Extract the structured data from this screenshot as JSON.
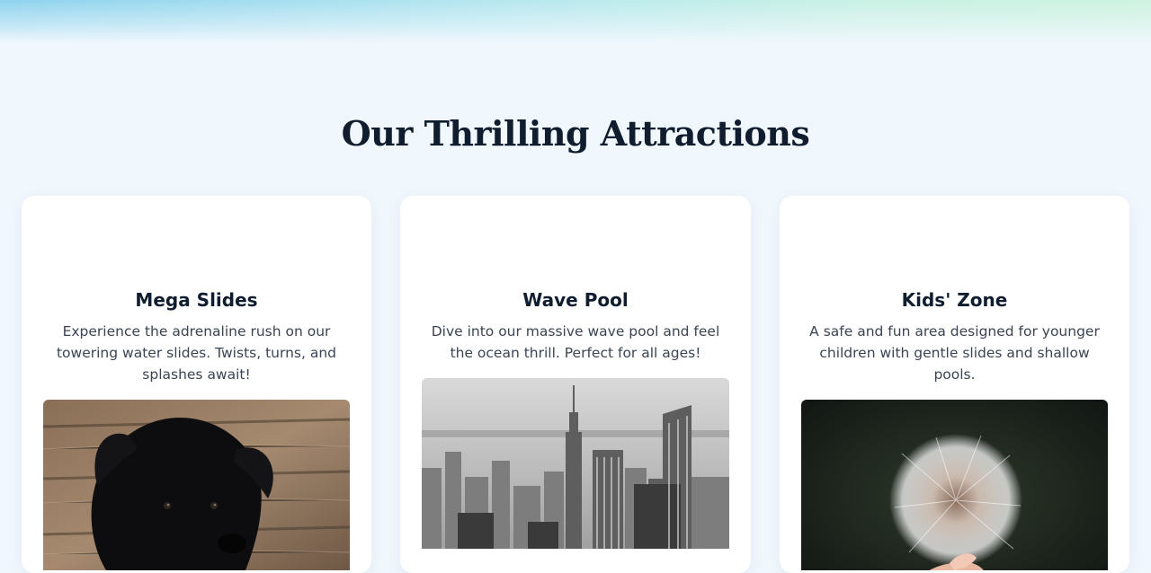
{
  "section": {
    "title": "Our Thrilling Attractions"
  },
  "attractions": [
    {
      "title": "Mega Slides",
      "description": "Experience the adrenaline rush on our towering water slides. Twists, turns, and splashes await!",
      "image": "black-puppy-photo"
    },
    {
      "title": "Wave Pool",
      "description": "Dive into our massive wave pool and feel the ocean thrill. Perfect for all ages!",
      "image": "city-skyline-photo"
    },
    {
      "title": "Kids' Zone",
      "description": "A safe and fun area designed for younger children with gentle slides and shallow pools.",
      "image": "dandelion-photo"
    }
  ],
  "colors": {
    "background": "#f0f7fd",
    "heading": "#0f1d2e",
    "body_text": "#3b4453",
    "card": "#ffffff"
  }
}
